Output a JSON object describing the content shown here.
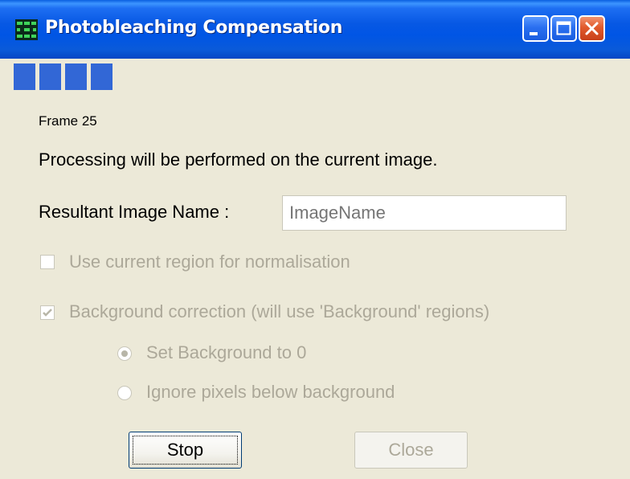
{
  "window": {
    "title": "Photobleaching Compensation",
    "icons": {
      "app": "app-grid-icon",
      "minimize": "minimize-icon",
      "maximize": "maximize-icon",
      "close": "close-icon"
    },
    "colors": {
      "titlebar": "#0055e5",
      "close_button": "#e15a2c",
      "progress": "#3267d6",
      "body": "#ece9d8",
      "disabled_text": "#aca899"
    }
  },
  "progress": {
    "filled_blocks": 4
  },
  "content": {
    "frame_label": "Frame 25",
    "processing_text": "Processing will be performed on the current image.",
    "result_name_label": "Resultant Image Name :",
    "result_name_placeholder": "ImageName",
    "use_region_label": "Use current region for normalisation",
    "use_region_checked": false,
    "background_correction_label": "Background correction (will use 'Background' regions)",
    "background_correction_checked": true,
    "radio_set_zero_label": "Set Background to 0",
    "radio_set_zero_selected": true,
    "radio_ignore_label": "Ignore pixels below background",
    "radio_ignore_selected": false
  },
  "buttons": {
    "stop_label": "Stop",
    "close_label": "Close"
  }
}
